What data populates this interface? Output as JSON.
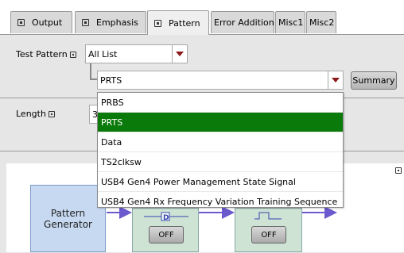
{
  "tabs": [
    {
      "label": "Output",
      "icon": "help-box-icon"
    },
    {
      "label": "Emphasis",
      "icon": "help-box-icon"
    },
    {
      "label": "Pattern",
      "icon": "help-box-icon",
      "active": true
    },
    {
      "label": "Error Addition"
    },
    {
      "label": "Misc1"
    },
    {
      "label": "Misc2"
    }
  ],
  "test_pattern": {
    "label": "Test Pattern",
    "category_value": "All List",
    "pattern_value": "PRTS",
    "summary_button": "Summary"
  },
  "length": {
    "label": "Length",
    "value_partial": "3"
  },
  "dropdown": {
    "items": [
      "PRBS",
      "PRTS",
      "Data",
      "TS2clksw",
      "USB4 Gen4 Power Management State Signal",
      "USB4 Gen4 Rx Frequency Variation Training Sequence"
    ],
    "selected": "PRTS"
  },
  "diagram": {
    "generator_line1": "Pattern",
    "generator_line2": "Generator",
    "block1_button": "OFF",
    "block2_button": "OFF"
  },
  "colors": {
    "selected_bg": "#0a7a0a",
    "arrow": "#6a5acd",
    "generator_fill": "#c6d9f0",
    "block_fill": "#cfe3d5",
    "dropdown_arrow": "#8b1a1a"
  }
}
